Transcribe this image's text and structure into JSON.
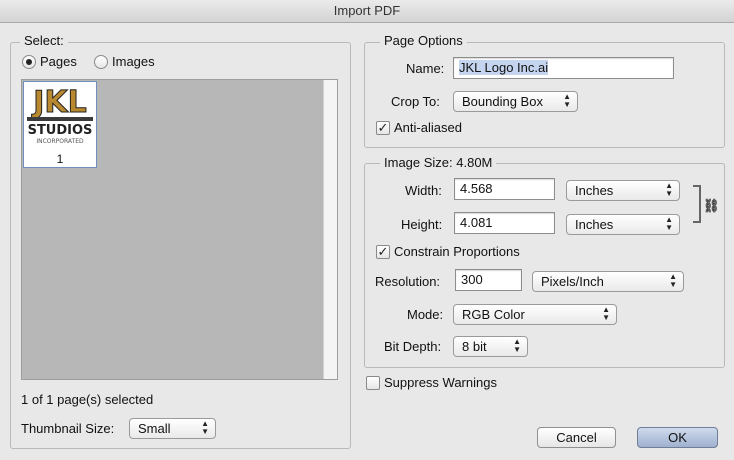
{
  "window": {
    "title": "Import PDF"
  },
  "select_group": {
    "legend": "Select:",
    "radio_pages": "Pages",
    "radio_images": "Images",
    "selected": "pages",
    "thumbnail": {
      "logo_top": "JKL",
      "logo_mid": "STUDIOS",
      "logo_bottom": "INCORPORATED",
      "page_number": "1"
    },
    "status": "1 of 1 page(s) selected",
    "thumbnail_size_label": "Thumbnail Size:",
    "thumbnail_size_value": "Small"
  },
  "page_options": {
    "legend": "Page Options",
    "name_label": "Name:",
    "name_value": "JKL Logo Inc.ai",
    "crop_label": "Crop To:",
    "crop_value": "Bounding Box",
    "anti_aliased_label": "Anti-aliased",
    "anti_aliased_checked": true
  },
  "image_size": {
    "legend": "Image Size: 4.80M",
    "width_label": "Width:",
    "width_value": "4.568",
    "width_unit": "Inches",
    "height_label": "Height:",
    "height_value": "4.081",
    "height_unit": "Inches",
    "constrain_label": "Constrain Proportions",
    "constrain_checked": true,
    "resolution_label": "Resolution:",
    "resolution_value": "300",
    "resolution_unit": "Pixels/Inch",
    "mode_label": "Mode:",
    "mode_value": "RGB Color",
    "bit_depth_label": "Bit Depth:",
    "bit_depth_value": "8 bit"
  },
  "suppress_warnings_label": "Suppress Warnings",
  "buttons": {
    "cancel": "Cancel",
    "ok": "OK"
  },
  "colors": {
    "default_button": "#a9bbd8",
    "thumb_logo": "#b8892e"
  }
}
